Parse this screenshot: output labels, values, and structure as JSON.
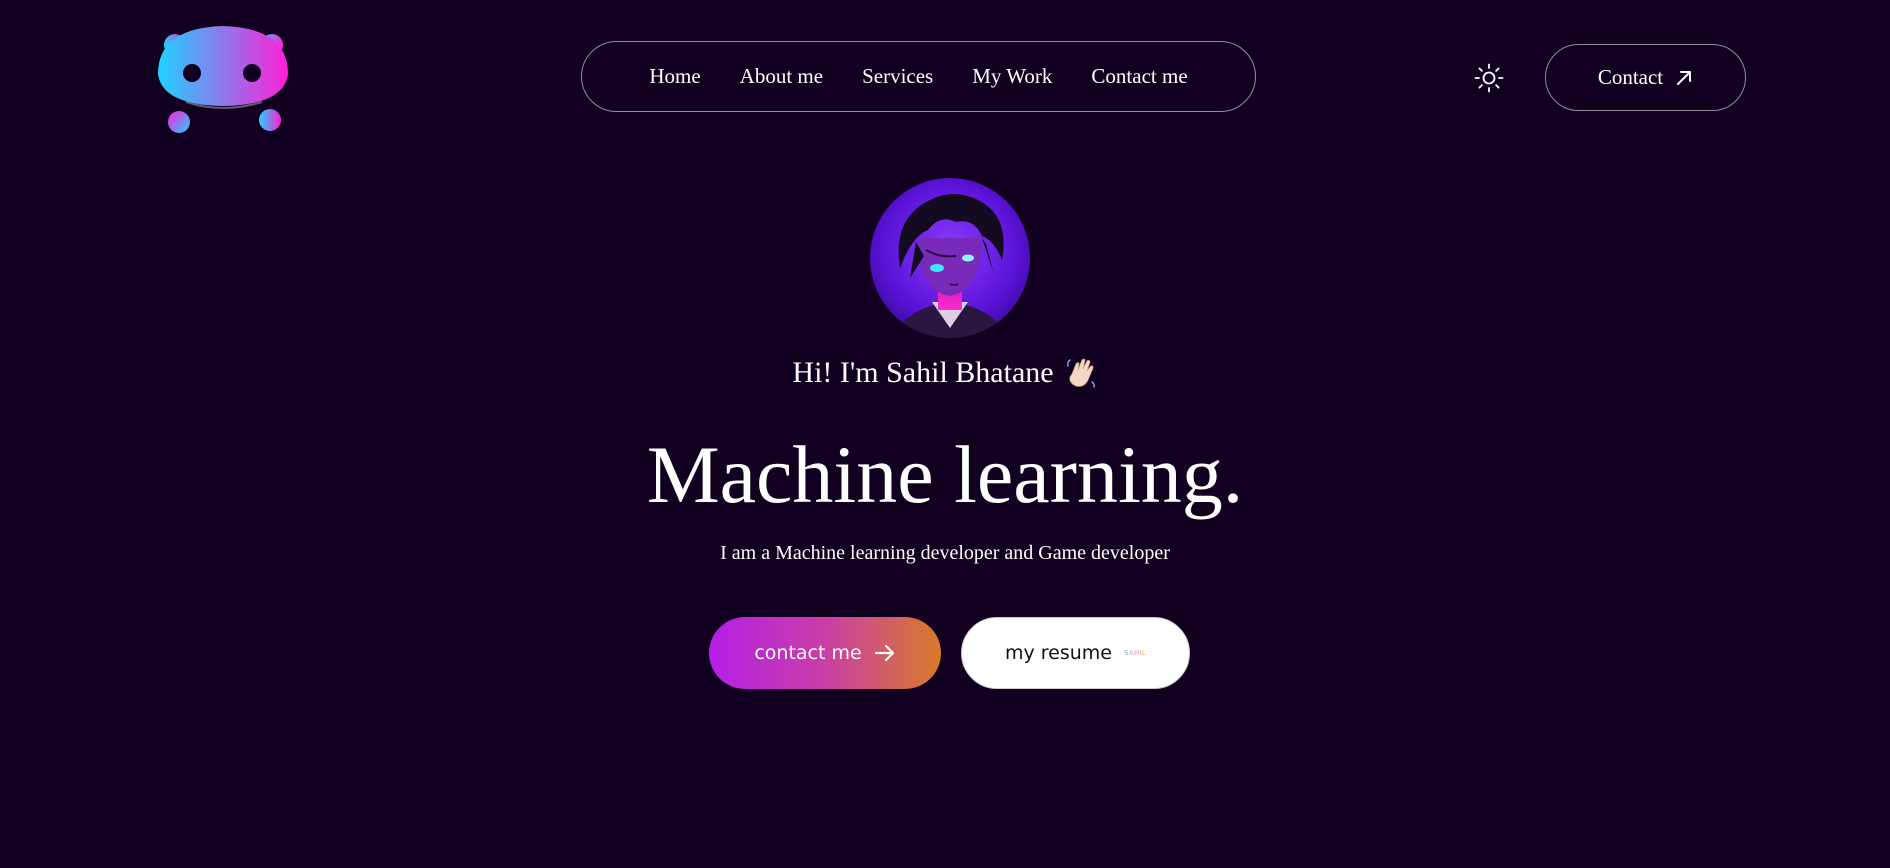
{
  "header": {
    "logo_icon": "robot-face-logo",
    "nav": [
      {
        "label": "Home"
      },
      {
        "label": "About me"
      },
      {
        "label": "Services"
      },
      {
        "label": "My Work"
      },
      {
        "label": "Contact me"
      }
    ],
    "theme_icon": "sun-icon",
    "contact_label": "Contact",
    "contact_icon": "arrow-up-right-icon"
  },
  "hero": {
    "avatar_icon": "anime-avatar",
    "greeting": "Hi! I'm Sahil Bhatane",
    "greeting_emoji": "👋🏻",
    "title": "Machine learning.",
    "subtitle": "I am a Machine learning developer and Game developer",
    "cta_contact_label": "contact me",
    "cta_contact_icon": "arrow-right-icon",
    "cta_resume_label": "my resume",
    "cta_resume_mark": "SAHIL"
  },
  "colors": {
    "background": "#11001f",
    "gradient_start": "#b41fe6",
    "gradient_end": "#d87a2a",
    "logo_cyan": "#1fd2ff",
    "logo_magenta": "#ff1fd6"
  }
}
